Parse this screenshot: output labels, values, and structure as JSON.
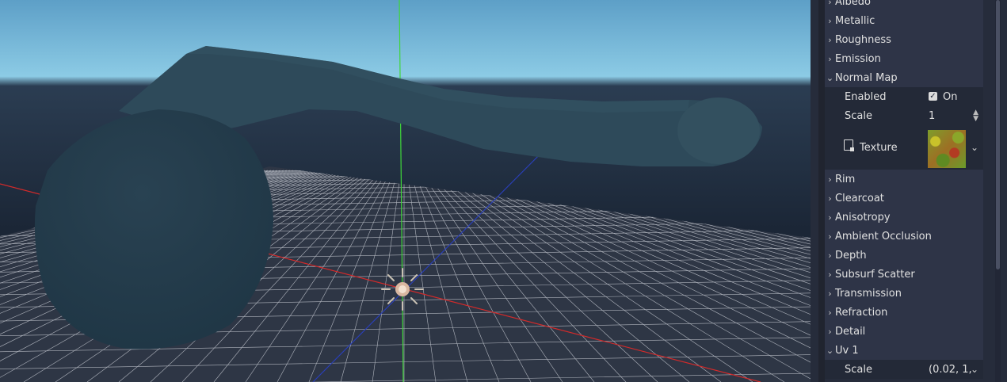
{
  "viewport": {
    "sky_top": "#5d9fc7",
    "sky_horizon": "#8ccbe5",
    "ground": "#1c2a3a",
    "mesh_color": "#2d4755"
  },
  "inspector": {
    "sections": [
      {
        "label": "Albedo",
        "expanded": false
      },
      {
        "label": "Metallic",
        "expanded": false
      },
      {
        "label": "Roughness",
        "expanded": false
      },
      {
        "label": "Emission",
        "expanded": false
      },
      {
        "label": "Normal Map",
        "expanded": true
      },
      {
        "label": "Rim",
        "expanded": false
      },
      {
        "label": "Clearcoat",
        "expanded": false
      },
      {
        "label": "Anisotropy",
        "expanded": false
      },
      {
        "label": "Ambient Occlusion",
        "expanded": false
      },
      {
        "label": "Depth",
        "expanded": false
      },
      {
        "label": "Subsurf Scatter",
        "expanded": false
      },
      {
        "label": "Transmission",
        "expanded": false
      },
      {
        "label": "Refraction",
        "expanded": false
      },
      {
        "label": "Detail",
        "expanded": false
      },
      {
        "label": "Uv 1",
        "expanded": true
      }
    ],
    "normal_map": {
      "enabled_label": "Enabled",
      "enabled_value": "On",
      "scale_label": "Scale",
      "scale_value": "1",
      "texture_label": "Texture"
    },
    "uv1": {
      "scale_label": "Scale",
      "scale_value": "(0.02, 1,"
    }
  }
}
